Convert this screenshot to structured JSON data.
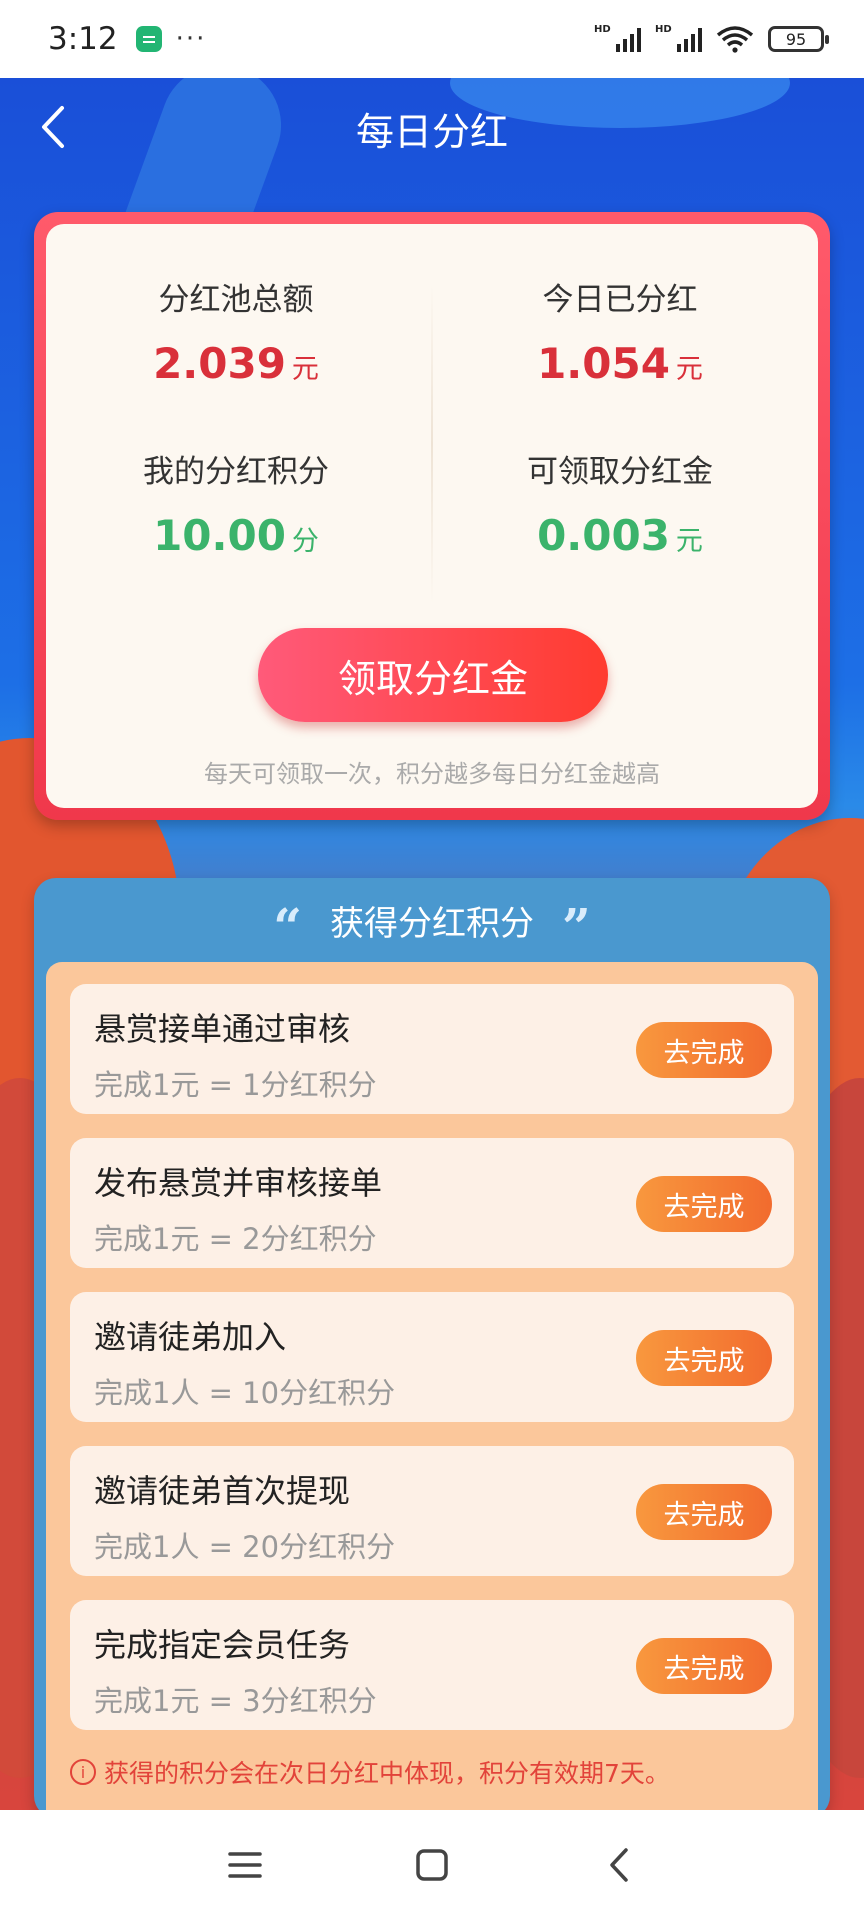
{
  "status_bar": {
    "time": "3:12",
    "dots": "···",
    "battery": "95",
    "signal_label": "HD"
  },
  "header": {
    "title": "每日分红"
  },
  "pool": {
    "total_label": "分红池总额",
    "total_value": "2.039",
    "total_unit": "元",
    "today_label": "今日已分红",
    "today_value": "1.054",
    "today_unit": "元",
    "points_label": "我的分红积分",
    "points_value": "10.00",
    "points_unit": "分",
    "claimable_label": "可领取分红金",
    "claimable_value": "0.003",
    "claimable_unit": "元",
    "claim_button": "领取分红金",
    "note": "每天可领取一次，积分越多每日分红金越高"
  },
  "tasks": {
    "title": "获得分红积分",
    "items": [
      {
        "name": "悬赏接单通过审核",
        "reward": "完成1元 = 1分红积分",
        "button": "去完成"
      },
      {
        "name": "发布悬赏并审核接单",
        "reward": "完成1元 = 2分红积分",
        "button": "去完成"
      },
      {
        "name": "邀请徒弟加入",
        "reward": "完成1人 = 10分红积分",
        "button": "去完成"
      },
      {
        "name": "邀请徒弟首次提现",
        "reward": "完成1人 = 20分红积分",
        "button": "去完成"
      },
      {
        "name": "完成指定会员任务",
        "reward": "完成1元 = 3分红积分",
        "button": "去完成"
      }
    ],
    "footnote": "获得的积分会在次日分红中体现，积分有效期7天。"
  },
  "icons": [
    "app-notification-icon",
    "signal-icon",
    "wifi-icon",
    "battery-icon",
    "back-arrow-icon",
    "quote-open-icon",
    "quote-close-icon",
    "info-icon",
    "menu-icon",
    "home-icon",
    "nav-back-icon"
  ],
  "colors": {
    "accent_red": "#d9303a",
    "accent_green": "#3bb36b",
    "button_orange": "#f26b2e",
    "panel_blue": "#4a98cf"
  }
}
